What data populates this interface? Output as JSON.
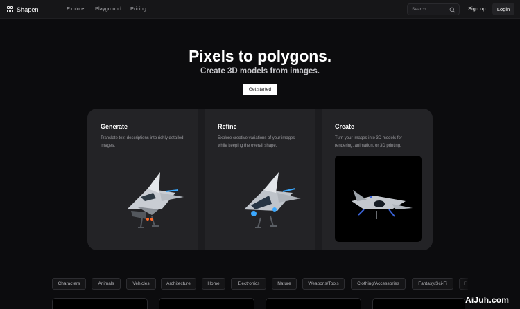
{
  "nav": {
    "brand": "Shapen",
    "links": [
      "Explore",
      "Playground",
      "Pricing"
    ],
    "search_placeholder": "Search",
    "signup_label": "Sign up",
    "login_label": "Login"
  },
  "hero": {
    "title": "Pixels to polygons.",
    "subtitle": "Create 3D models from images.",
    "cta_label": "Get started"
  },
  "cards": [
    {
      "title": "Generate",
      "description": "Translate text descriptions into richly detailed images."
    },
    {
      "title": "Refine",
      "description": "Explore creative variations of your images while keeping the overall shape."
    },
    {
      "title": "Create",
      "description": "Turn your images into 3D models for rendering, animation, or 3D printing."
    }
  ],
  "categories": [
    "Characters",
    "Animals",
    "Vehicles",
    "Architecture",
    "Home",
    "Electronics",
    "Nature",
    "Weapons/Tools",
    "Clothing/Accessories",
    "Fantasy/Sci-Fi",
    "F"
  ],
  "watermark": "AiJuh.com",
  "colors": {
    "background": "#0c0c0e",
    "card": "#232326",
    "nav": "#161618",
    "accent_blue": "#3aa8ff"
  }
}
